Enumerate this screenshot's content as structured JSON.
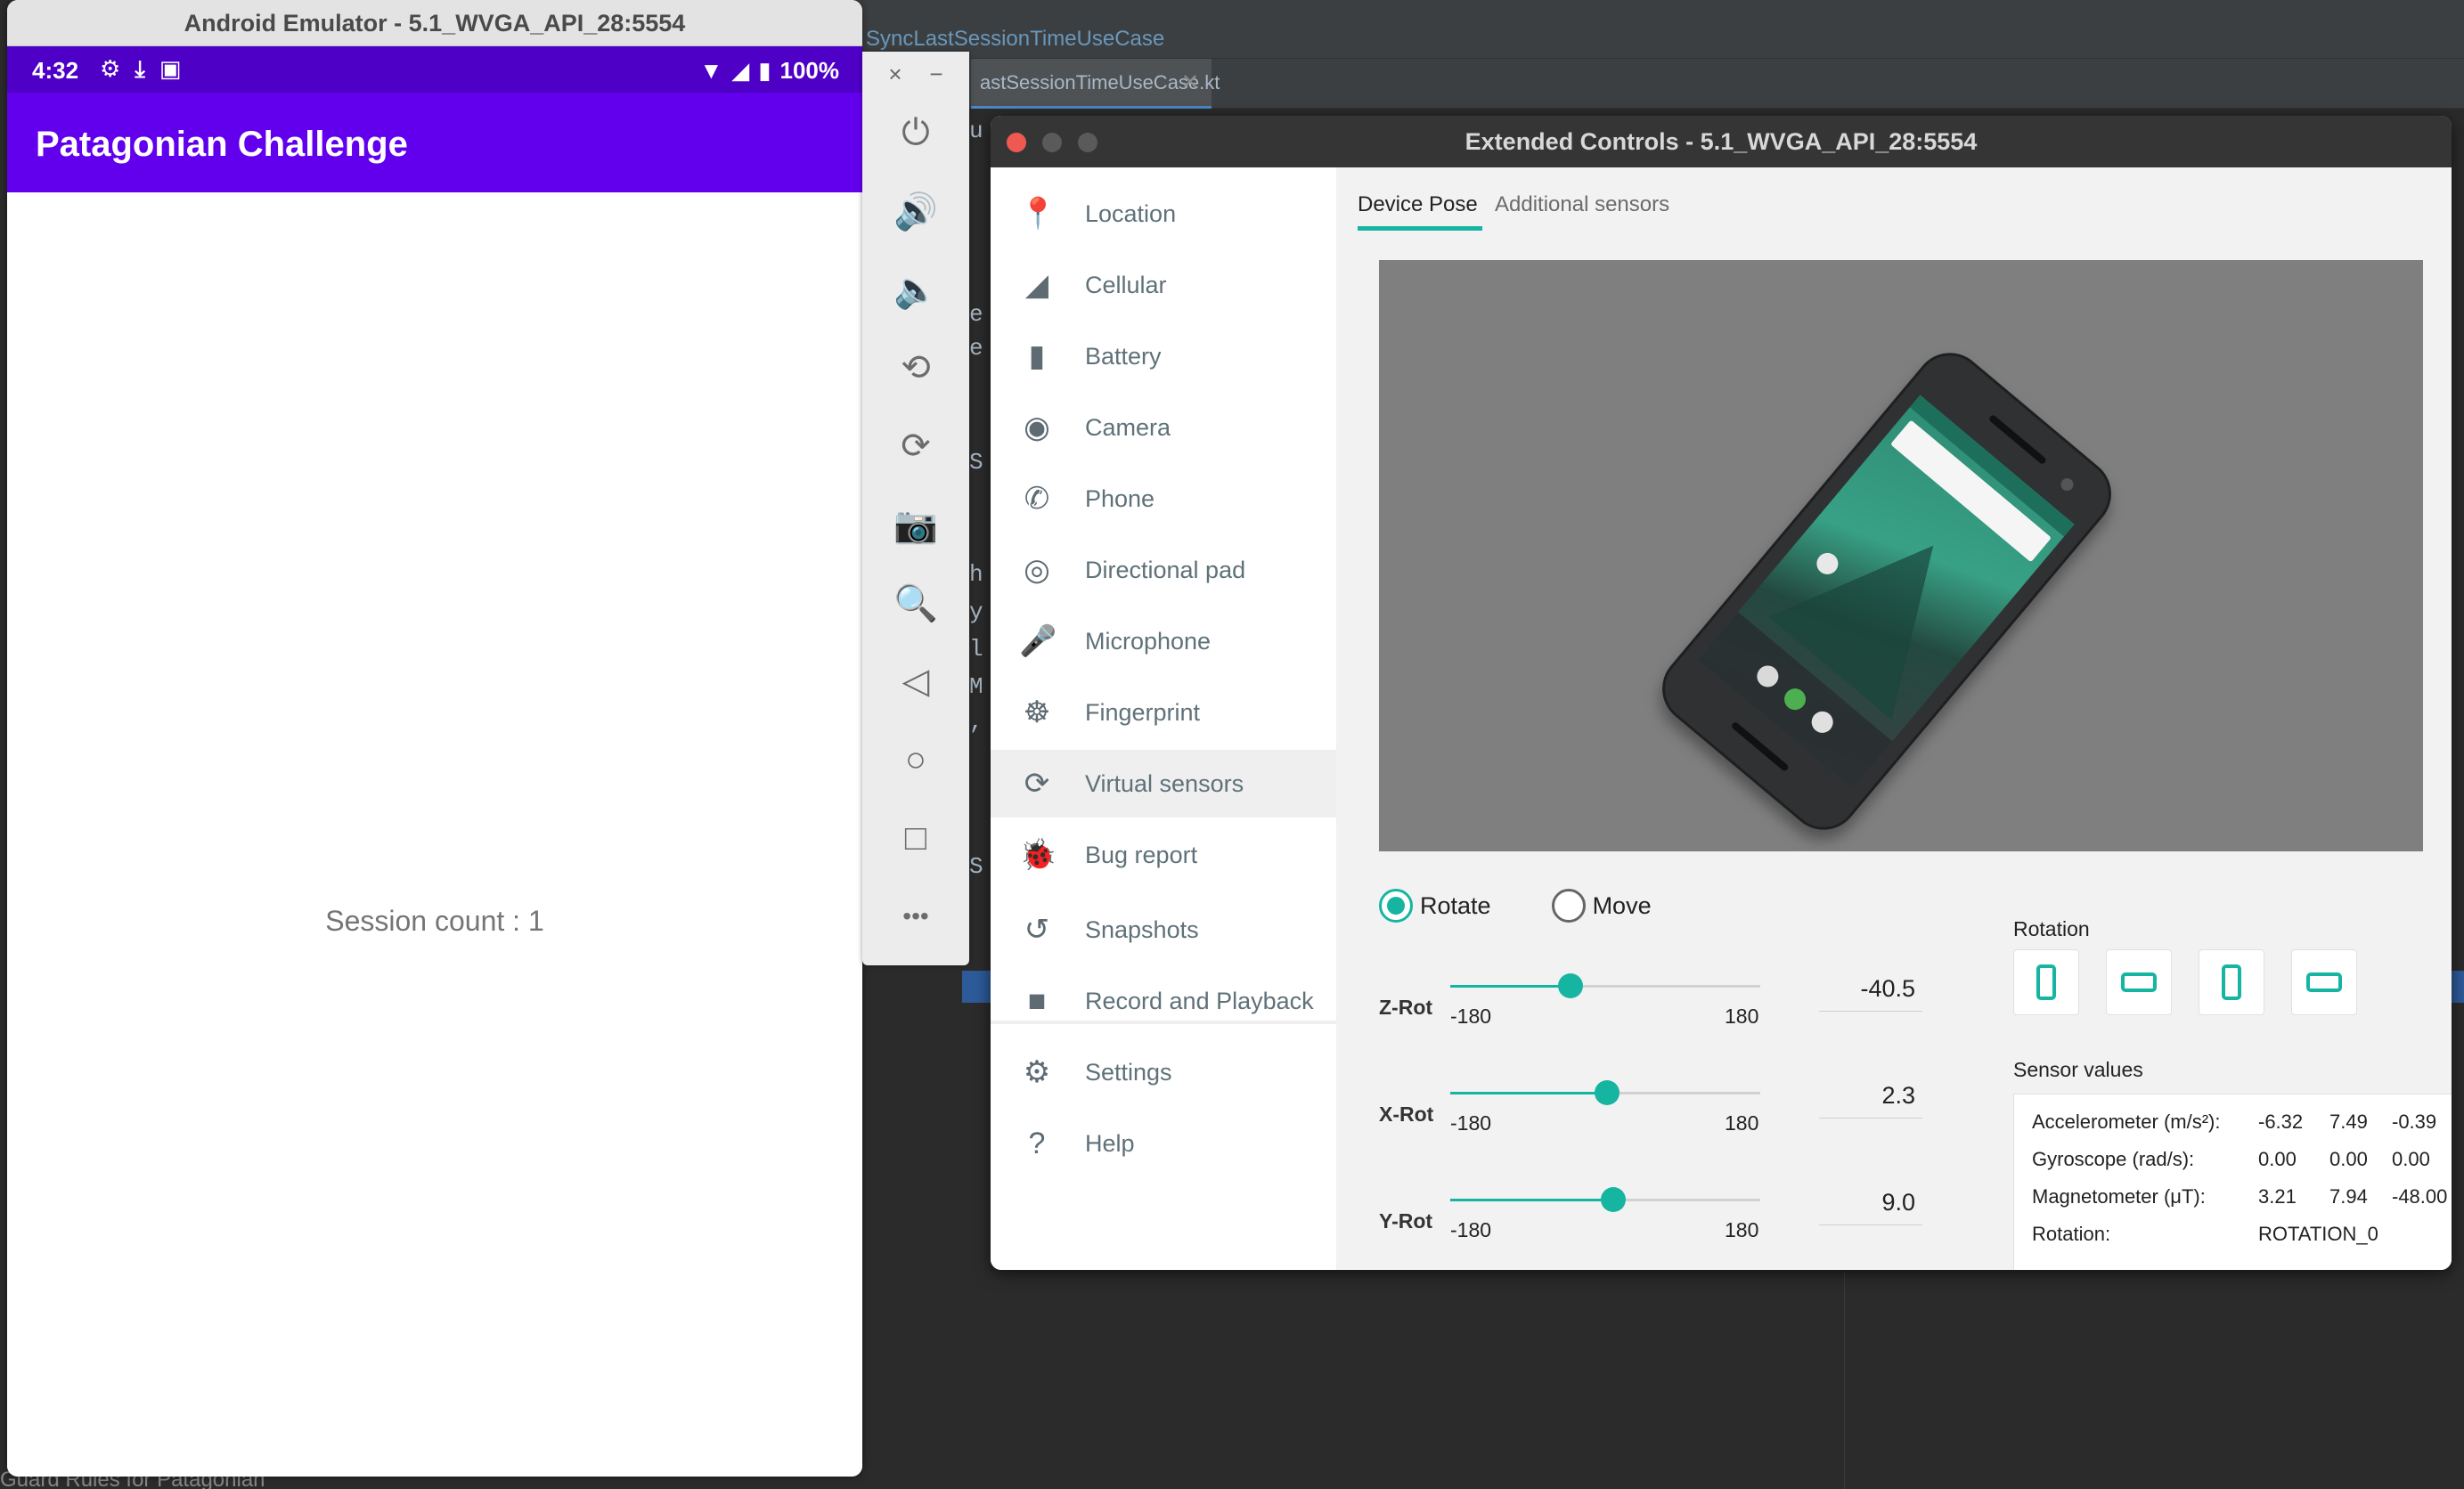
{
  "ide": {
    "breadcrumb": "SyncLastSessionTimeUseCase",
    "tab_label": "astSessionTimeUseCase.kt",
    "tab_close": "✕",
    "gutter_chars": [
      "u",
      "e",
      "e",
      "S",
      "h",
      "y",
      "l",
      "M",
      ",",
      "S"
    ],
    "bottom_text": "Guard Rules for Patagonian"
  },
  "emulator": {
    "window_title": "Android Emulator - 5.1_WVGA_API_28:5554",
    "status": {
      "time": "4:32",
      "battery": "100%"
    },
    "app_title": "Patagonian Challenge",
    "session_text": "Session count : 1",
    "toolbar": {
      "close": "×",
      "minimize": "−",
      "buttons": [
        {
          "name": "power-icon",
          "glyph": "⏻"
        },
        {
          "name": "volume-up-icon",
          "glyph": "🔊"
        },
        {
          "name": "volume-down-icon",
          "glyph": "🔈"
        },
        {
          "name": "rotate-left-icon",
          "glyph": "⟲"
        },
        {
          "name": "rotate-right-icon",
          "glyph": "⟳"
        },
        {
          "name": "camera-icon",
          "glyph": "📷"
        },
        {
          "name": "zoom-icon",
          "glyph": "🔍"
        },
        {
          "name": "back-icon",
          "glyph": "◁"
        },
        {
          "name": "home-icon",
          "glyph": "○"
        },
        {
          "name": "overview-icon",
          "glyph": "□"
        },
        {
          "name": "more-icon",
          "glyph": "•••"
        }
      ]
    }
  },
  "extended": {
    "window_title": "Extended Controls - 5.1_WVGA_API_28:5554",
    "nav": [
      {
        "label": "Location",
        "icon": "location-pin-icon",
        "glyph": "📍"
      },
      {
        "label": "Cellular",
        "icon": "signal-icon",
        "glyph": "◢"
      },
      {
        "label": "Battery",
        "icon": "battery-icon",
        "glyph": "▮"
      },
      {
        "label": "Camera",
        "icon": "aperture-icon",
        "glyph": "◉"
      },
      {
        "label": "Phone",
        "icon": "phone-icon",
        "glyph": "✆"
      },
      {
        "label": "Directional pad",
        "icon": "dpad-icon",
        "glyph": "◎"
      },
      {
        "label": "Microphone",
        "icon": "microphone-icon",
        "glyph": "🎤"
      },
      {
        "label": "Fingerprint",
        "icon": "fingerprint-icon",
        "glyph": "☸"
      },
      {
        "label": "Virtual sensors",
        "icon": "sensors-icon",
        "glyph": "⟳"
      },
      {
        "label": "Bug report",
        "icon": "bug-icon",
        "glyph": "🐞"
      },
      {
        "label": "Snapshots",
        "icon": "history-icon",
        "glyph": "↺"
      },
      {
        "label": "Record and Playback",
        "icon": "video-camera-icon",
        "glyph": "■"
      },
      {
        "label": "Settings",
        "icon": "gear-icon",
        "glyph": "⚙"
      },
      {
        "label": "Help",
        "icon": "help-icon",
        "glyph": "?"
      }
    ],
    "active_nav": "Virtual sensors",
    "tabs": {
      "active": "Device Pose",
      "inactive": "Additional sensors"
    },
    "mode": {
      "rotate": "Rotate",
      "move": "Move",
      "selected": "Rotate"
    },
    "sliders": [
      {
        "label": "Z-Rot",
        "min": "-180",
        "max": "180",
        "value": -40.5,
        "display": "-40.5"
      },
      {
        "label": "X-Rot",
        "min": "-180",
        "max": "180",
        "value": 2.3,
        "display": "2.3"
      },
      {
        "label": "Y-Rot",
        "min": "-180",
        "max": "180",
        "value": 9.0,
        "display": "9.0"
      }
    ],
    "rotation_title": "Rotation",
    "sensor_title": "Sensor values",
    "sensors": [
      {
        "name": "Accelerometer (m/s²):",
        "v1": "-6.32",
        "v2": "7.49",
        "v3": "-0.39"
      },
      {
        "name": "Gyroscope (rad/s):",
        "v1": "0.00",
        "v2": "0.00",
        "v3": "0.00"
      },
      {
        "name": "Magnetometer (μT):",
        "v1": "3.21",
        "v2": "7.94",
        "v3": "-48.00"
      },
      {
        "name": "Rotation:",
        "v1": "ROTATION_0",
        "v2": "",
        "v3": ""
      }
    ],
    "colors": {
      "accent": "#16b5a1",
      "app_bar": "#6200ee",
      "status_bar": "#4e00c7"
    }
  }
}
